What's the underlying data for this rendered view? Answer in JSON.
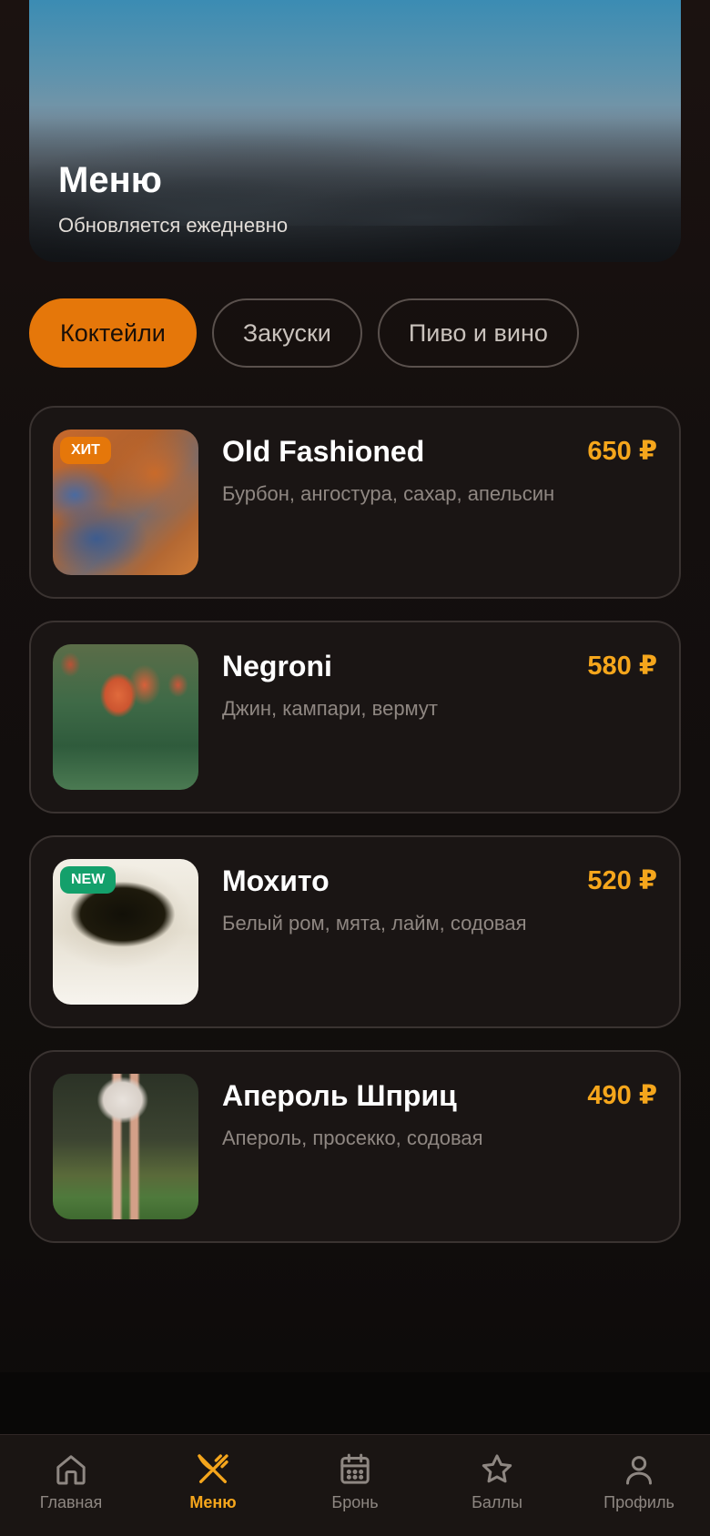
{
  "hero": {
    "title": "Меню",
    "subtitle": "Обновляется ежедневно"
  },
  "tabs": [
    {
      "label": "Коктейли",
      "active": true
    },
    {
      "label": "Закуски",
      "active": false
    },
    {
      "label": "Пиво и вино",
      "active": false
    }
  ],
  "items": [
    {
      "name": "Old Fashioned",
      "description": "Бурбон, ангостура, сахар, апельсин",
      "price": "650 ₽",
      "badge": "ХИТ"
    },
    {
      "name": "Negroni",
      "description": "Джин, кампари, вермут",
      "price": "580 ₽",
      "badge": ""
    },
    {
      "name": "Мохито",
      "description": "Белый ром, мята, лайм, содовая",
      "price": "520 ₽",
      "badge": "NEW"
    },
    {
      "name": "Апероль Шприц",
      "description": "Апероль, просекко, содовая",
      "price": "490 ₽",
      "badge": ""
    }
  ],
  "nav": [
    {
      "label": "Главная",
      "icon": "home-icon",
      "active": false
    },
    {
      "label": "Меню",
      "icon": "utensils-icon",
      "active": true
    },
    {
      "label": "Бронь",
      "icon": "calendar-icon",
      "active": false
    },
    {
      "label": "Баллы",
      "icon": "star-icon",
      "active": false
    },
    {
      "label": "Профиль",
      "icon": "user-icon",
      "active": false
    }
  ],
  "colors": {
    "accent": "#e5770a",
    "price": "#f5a61c",
    "badge_new": "#14a06b",
    "background": "#120e0d"
  }
}
